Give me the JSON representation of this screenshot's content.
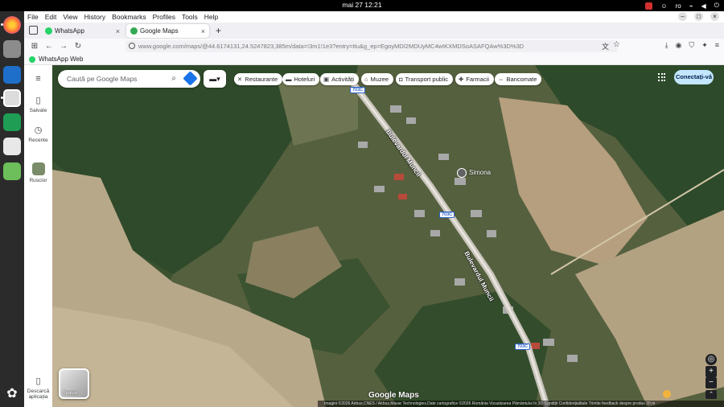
{
  "system": {
    "clock": "mai 27  12:21",
    "lang": "ro"
  },
  "browser": {
    "menu": [
      "File",
      "Edit",
      "View",
      "History",
      "Bookmarks",
      "Profiles",
      "Tools",
      "Help"
    ],
    "tabs": [
      {
        "label": "WhatsApp"
      },
      {
        "label": "Google Maps"
      }
    ],
    "url": "www.google.com/maps/@44.6174131,24.5247823,385m/data=!3m1!1e3?entry=ttu&g_ep=EgoyMDI2MDUyMC4wIKXMDSoASAFQAw%3D%3D",
    "bookmark": "WhatsApp Web"
  },
  "maps": {
    "rail": {
      "saved": "Salvate",
      "recent": "Recente",
      "shortcut": "Ruscior",
      "download": "Descarcă aplicația"
    },
    "search_placeholder": "Caută pe Google Maps",
    "chips": [
      "Restaurante",
      "Hoteluri",
      "Activități",
      "Muzee",
      "Transport public",
      "Farmacii",
      "Bancomate"
    ],
    "sign_in": "Conectați-vă",
    "road_name": "Bulevardul Muncii",
    "road_number": "703C",
    "place_label": "Simona",
    "layers_label": "Straturi",
    "logo": "Google Maps",
    "attribution": "Imagini ©2026 Airbus,CNES / Airbus,Maxar Technologies,Date cartografice ©2026     România     Vizualizarea Pământului în 3D     Condiții     Confidențialitate     Trimite feedback despre produs     20 m"
  },
  "colors": {
    "accent": "#1a73e8",
    "signin_bg": "#c2e7ff"
  }
}
